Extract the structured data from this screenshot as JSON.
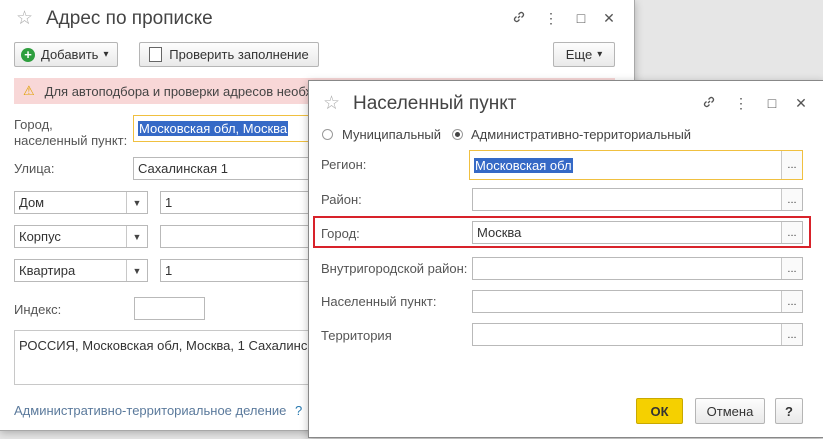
{
  "back": {
    "title": "Адрес по прописке",
    "toolbar": {
      "add_label": "Добавить",
      "check_label": "Проверить заполнение",
      "more_label": "Еще"
    },
    "warning": "Для автоподбора и проверки адресов необх",
    "city_label": "Город, населенный пункт:",
    "city_value": "Московская обл, Москва",
    "street_label": "Улица:",
    "street_value": "Сахалинская 1",
    "house_type": "Дом",
    "house_value": "1",
    "korpus_type": "Корпус",
    "korpus_value": "",
    "flat_type": "Квартира",
    "flat_value": "1",
    "index_label": "Индекс:",
    "index_value": "",
    "address_text": "РОССИЯ, Московская обл, Москва, 1 Сахалинск",
    "admin_link": "Административно-территориальное деление",
    "help_mark": "?"
  },
  "front": {
    "title": "Населенный пункт",
    "radio_municipal": "Муниципальный",
    "radio_admin": "Административно-территориальный",
    "region_label": "Регион:",
    "region_value": "Московская обл",
    "district_label": "Район:",
    "district_value": "",
    "city_label": "Город:",
    "city_value": "Москва",
    "intracity_label": "Внутригородской район:",
    "intracity_value": "",
    "settlement_label": "Населенный пункт:",
    "settlement_value": "",
    "territory_label": "Территория",
    "territory_value": "",
    "ok_label": "ОК",
    "cancel_label": "Отмена",
    "help_label": "?",
    "choice_glyph": "..."
  },
  "icons": {
    "star": "☆",
    "link": "🔗",
    "menu": "⋮",
    "maximize": "□",
    "close": "✕",
    "add": "+",
    "warning": "⚠",
    "dropdown": "▾"
  },
  "colors": {
    "warning_bg": "#f8d7d7",
    "focus": "#f0c040",
    "highlight": "#d8222a",
    "ok_bg": "#f5d000",
    "link": "#5b7a9c"
  }
}
